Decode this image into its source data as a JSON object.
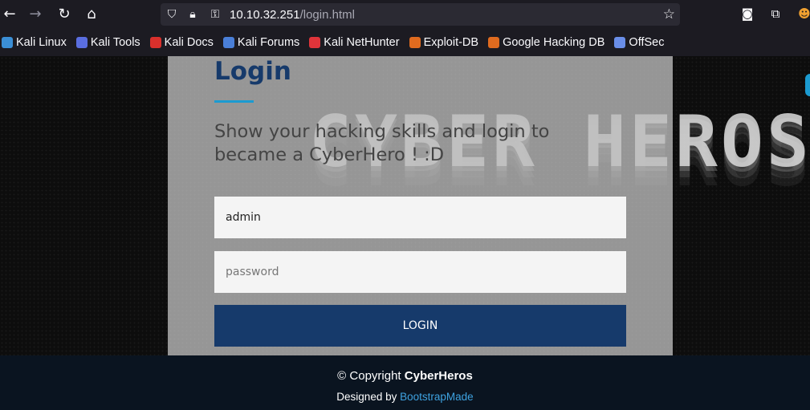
{
  "browser": {
    "url_host": "10.10.32.251",
    "url_path": "/login.html",
    "icons": [
      "back-icon",
      "forward-icon",
      "reload-icon",
      "home-icon",
      "shield-icon",
      "lock-icon",
      "key-icon",
      "star-icon",
      "pocket-icon",
      "extensions-icon",
      "profile-icon"
    ]
  },
  "bookmarks": [
    {
      "label": "Kali Linux",
      "color": "#3b8fd6"
    },
    {
      "label": "Kali Tools",
      "color": "#5a6ee0"
    },
    {
      "label": "Kali Docs",
      "color": "#d9302c"
    },
    {
      "label": "Kali Forums",
      "color": "#4a7fd8"
    },
    {
      "label": "Kali NetHunter",
      "color": "#e0343a"
    },
    {
      "label": "Exploit-DB",
      "color": "#e06b1f"
    },
    {
      "label": "Google Hacking DB",
      "color": "#e06b1f"
    },
    {
      "label": "OffSec",
      "color": "#6a8ee8"
    }
  ],
  "page": {
    "hero_text": "CYBER HEROS",
    "login_title": "Login",
    "subtitle": "Show your hacking skills and login to became a CyberHero ! :D",
    "username_value": "admin",
    "password_placeholder": "password",
    "login_button": "LOGIN"
  },
  "footer": {
    "copyright_prefix": "© Copyright",
    "copyright_brand": "CyberHeros",
    "designed_prefix": "Designed by",
    "designed_link": "BootstrapMade"
  },
  "colors": {
    "accent": "#1b9bd1",
    "button": "#163a6b",
    "title": "#163a6b",
    "link": "#3ea2e0"
  }
}
